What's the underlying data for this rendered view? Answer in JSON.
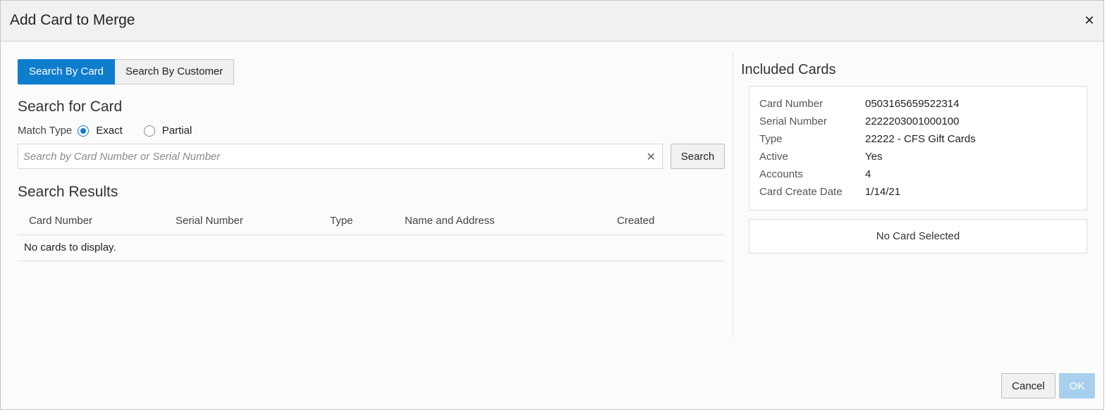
{
  "dialog": {
    "title": "Add Card to Merge",
    "close_icon": "close-icon"
  },
  "tabs": [
    {
      "label": "Search By Card",
      "active": true
    },
    {
      "label": "Search By Customer",
      "active": false
    }
  ],
  "search": {
    "heading": "Search for Card",
    "match_type_label": "Match Type",
    "options": [
      {
        "label": "Exact",
        "selected": true
      },
      {
        "label": "Partial",
        "selected": false
      }
    ],
    "placeholder": "Search by Card Number or Serial Number",
    "value": "",
    "button_label": "Search"
  },
  "results": {
    "heading": "Search Results",
    "columns": [
      "Card Number",
      "Serial Number",
      "Type",
      "Name and Address",
      "Created"
    ],
    "empty_message": "No cards to display."
  },
  "included_cards": {
    "heading": "Included Cards",
    "details": [
      {
        "label": "Card Number",
        "value": "0503165659522314"
      },
      {
        "label": "Serial Number",
        "value": "2222203001000100"
      },
      {
        "label": "Type",
        "value": "22222 - CFS Gift Cards"
      },
      {
        "label": "Active",
        "value": "Yes"
      },
      {
        "label": "Accounts",
        "value": "4"
      },
      {
        "label": "Card Create Date",
        "value": "1/14/21"
      }
    ],
    "empty_message": "No Card Selected"
  },
  "footer": {
    "cancel_label": "Cancel",
    "ok_label": "OK"
  },
  "colors": {
    "accent": "#0f7dcd",
    "ok_disabled": "#a8d0ee"
  }
}
